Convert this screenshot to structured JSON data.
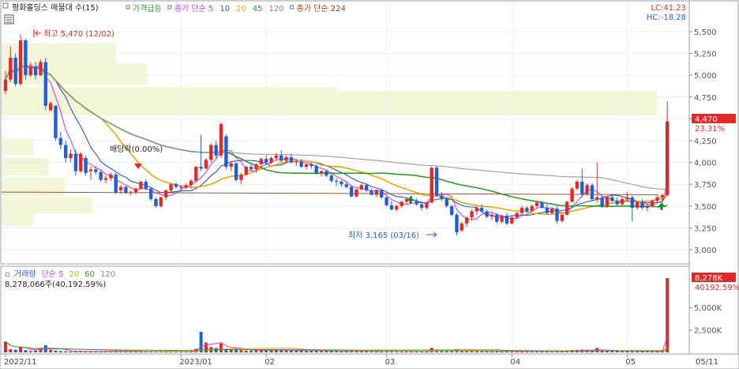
{
  "header": {
    "stock_title": "평화홀딩스 매물대 수(15)",
    "legend_items": [
      {
        "label": "가격급등",
        "color": "#2e9a2e"
      },
      {
        "label": "종가 단순 5",
        "color": "#d63bd6"
      },
      {
        "label": "10",
        "color": "#2b55d0"
      },
      {
        "label": "20",
        "color": "#e6a800"
      },
      {
        "label": "45",
        "color": "#2e9a2e"
      },
      {
        "label": "120",
        "color": "#888888"
      },
      {
        "label": "종가 단순 224",
        "color": "#8b4513"
      }
    ],
    "lc_label": "LC:41.23",
    "hc_label": "HC:-18.28"
  },
  "annotations": {
    "high_label": "최고 5,470 (12/02)",
    "low_label": "최저 3,165 (03/16)",
    "dividend_label": "배당락(0.00%)"
  },
  "price_panel": {
    "current_price": "4,470",
    "change_pct": "23.31%",
    "y_ticks": [
      "5,500",
      "5,250",
      "5,000",
      "4,750",
      "4,500",
      "4,250",
      "4,000",
      "3,750",
      "3,500",
      "3,250",
      "3,000"
    ]
  },
  "volume_panel": {
    "legend": [
      {
        "label": "거래량",
        "color": "#2b55d0"
      },
      {
        "label": "단순 5",
        "color": "#d63bd6"
      },
      {
        "label": "20",
        "color": "#e6a800"
      },
      {
        "label": "60",
        "color": "#2e9a2e"
      },
      {
        "label": "120",
        "color": "#888888"
      }
    ],
    "summary": "8,278,066주(40,192.59%)",
    "current_volume": "8,278K",
    "current_pct": "40192.59%",
    "y_ticks": [
      "5,000K",
      "2,500K"
    ]
  },
  "x_axis": {
    "labels": [
      "2022/11",
      "2023/01",
      "02",
      "03",
      "04",
      "05",
      "05/11"
    ]
  },
  "colors": {
    "up": "#e02a2a",
    "down": "#2060d0",
    "ma5": "#d63bd6",
    "ma10": "#2b55d0",
    "ma20": "#e6a800",
    "ma45": "#2e9a2e",
    "ma120": "#999999",
    "ma224": "#a0522d",
    "volume_profile": "#f3f6d6"
  },
  "chart_data": {
    "type": "candlestick",
    "title": "평화홀딩스 매물대 수(15)",
    "ylim": [
      2850,
      5600
    ],
    "annotations": {
      "high": {
        "value": 5470,
        "date": "12/02"
      },
      "low": {
        "value": 3165,
        "date": "03/16"
      },
      "last": {
        "value": 4470,
        "change_pct": 23.31
      }
    },
    "ohlc": [
      [
        4820,
        5050,
        4780,
        4950
      ],
      [
        4950,
        5330,
        4920,
        5200
      ],
      [
        5200,
        5250,
        4870,
        4900
      ],
      [
        4900,
        5470,
        4880,
        5400
      ],
      [
        5400,
        5420,
        4950,
        5000
      ],
      [
        5000,
        5150,
        4980,
        5100
      ],
      [
        5100,
        5150,
        4950,
        5000
      ],
      [
        5000,
        5180,
        4990,
        5150
      ],
      [
        5150,
        5200,
        4600,
        4650
      ],
      [
        4600,
        4700,
        4580,
        4680
      ],
      [
        4650,
        4660,
        4250,
        4280
      ],
      [
        4280,
        4350,
        4150,
        4200
      ],
      [
        4200,
        4250,
        4000,
        4050
      ],
      [
        4050,
        4150,
        4000,
        4100
      ],
      [
        4100,
        4150,
        3850,
        3900
      ],
      [
        3900,
        4120,
        3880,
        4100
      ],
      [
        4050,
        4080,
        3850,
        3880
      ],
      [
        3900,
        3950,
        3800,
        3920
      ],
      [
        3920,
        3960,
        3860,
        3890
      ],
      [
        3890,
        3910,
        3780,
        3800
      ],
      [
        3800,
        3850,
        3760,
        3820
      ],
      [
        3820,
        3880,
        3790,
        3860
      ],
      [
        3860,
        3880,
        3640,
        3660
      ],
      [
        3680,
        3740,
        3640,
        3720
      ],
      [
        3720,
        3730,
        3640,
        3650
      ],
      [
        3650,
        3680,
        3620,
        3660
      ],
      [
        3660,
        3720,
        3640,
        3700
      ],
      [
        3700,
        3790,
        3690,
        3780
      ],
      [
        3780,
        3810,
        3680,
        3700
      ],
      [
        3700,
        3720,
        3560,
        3580
      ],
      [
        3580,
        3600,
        3480,
        3500
      ],
      [
        3500,
        3610,
        3480,
        3600
      ],
      [
        3600,
        3690,
        3570,
        3680
      ],
      [
        3680,
        3760,
        3650,
        3750
      ],
      [
        3750,
        3770,
        3700,
        3720
      ],
      [
        3720,
        3740,
        3680,
        3710
      ],
      [
        3710,
        3760,
        3690,
        3740
      ],
      [
        3740,
        3810,
        3700,
        3790
      ],
      [
        3790,
        3960,
        3770,
        3950
      ],
      [
        3950,
        4320,
        3900,
        3930
      ],
      [
        3930,
        4050,
        3920,
        4030
      ],
      [
        4030,
        4220,
        4000,
        4200
      ],
      [
        4200,
        4250,
        4050,
        4080
      ],
      [
        4080,
        4460,
        4050,
        4440
      ],
      [
        4300,
        4320,
        3920,
        3950
      ],
      [
        3950,
        4010,
        3900,
        3990
      ],
      [
        3990,
        4000,
        3780,
        3800
      ],
      [
        3800,
        3880,
        3750,
        3860
      ],
      [
        3860,
        3960,
        3850,
        3950
      ],
      [
        3950,
        3980,
        3900,
        3920
      ],
      [
        3920,
        3990,
        3880,
        3980
      ],
      [
        3980,
        4060,
        3950,
        4040
      ],
      [
        4040,
        4080,
        3970,
        4000
      ],
      [
        4000,
        4070,
        3980,
        4050
      ],
      [
        4050,
        4110,
        4020,
        4080
      ],
      [
        4080,
        4140,
        4000,
        4020
      ],
      [
        4020,
        4080,
        3990,
        4060
      ],
      [
        4060,
        4100,
        3990,
        4000
      ],
      [
        4000,
        4030,
        3960,
        4010
      ],
      [
        4010,
        4040,
        3940,
        3950
      ],
      [
        3950,
        3990,
        3920,
        3980
      ],
      [
        3980,
        4000,
        3930,
        3960
      ],
      [
        3960,
        3980,
        3860,
        3880
      ],
      [
        3880,
        3910,
        3840,
        3900
      ],
      [
        3900,
        3920,
        3830,
        3850
      ],
      [
        3850,
        3870,
        3770,
        3790
      ],
      [
        3790,
        3820,
        3730,
        3780
      ],
      [
        3780,
        3800,
        3720,
        3750
      ],
      [
        3750,
        3780,
        3700,
        3720
      ],
      [
        3720,
        3740,
        3600,
        3610
      ],
      [
        3610,
        3700,
        3600,
        3690
      ],
      [
        3690,
        3760,
        3680,
        3740
      ],
      [
        3740,
        3760,
        3660,
        3680
      ],
      [
        3680,
        3700,
        3620,
        3630
      ],
      [
        3630,
        3690,
        3600,
        3680
      ],
      [
        3680,
        3700,
        3580,
        3600
      ],
      [
        3600,
        3610,
        3500,
        3510
      ],
      [
        3510,
        3560,
        3450,
        3460
      ],
      [
        3460,
        3520,
        3440,
        3500
      ],
      [
        3500,
        3560,
        3480,
        3550
      ],
      [
        3550,
        3600,
        3520,
        3580
      ],
      [
        3580,
        3620,
        3540,
        3560
      ],
      [
        3560,
        3590,
        3500,
        3520
      ],
      [
        3520,
        3540,
        3450,
        3480
      ],
      [
        3480,
        3550,
        3460,
        3540
      ],
      [
        3540,
        3950,
        3530,
        3940
      ],
      [
        3940,
        3960,
        3600,
        3620
      ],
      [
        3620,
        3660,
        3560,
        3580
      ],
      [
        3580,
        3600,
        3480,
        3500
      ],
      [
        3500,
        3510,
        3380,
        3400
      ],
      [
        3400,
        3420,
        3165,
        3200
      ],
      [
        3220,
        3320,
        3200,
        3300
      ],
      [
        3300,
        3380,
        3260,
        3370
      ],
      [
        3370,
        3460,
        3340,
        3440
      ],
      [
        3440,
        3500,
        3400,
        3480
      ],
      [
        3480,
        3520,
        3420,
        3440
      ],
      [
        3440,
        3460,
        3360,
        3380
      ],
      [
        3380,
        3420,
        3340,
        3400
      ],
      [
        3400,
        3420,
        3300,
        3320
      ],
      [
        3320,
        3400,
        3300,
        3390
      ],
      [
        3390,
        3420,
        3280,
        3300
      ],
      [
        3300,
        3380,
        3290,
        3370
      ],
      [
        3370,
        3430,
        3350,
        3420
      ],
      [
        3420,
        3500,
        3400,
        3480
      ],
      [
        3480,
        3500,
        3420,
        3440
      ],
      [
        3440,
        3520,
        3430,
        3500
      ],
      [
        3500,
        3560,
        3480,
        3540
      ],
      [
        3540,
        3560,
        3470,
        3480
      ],
      [
        3480,
        3520,
        3400,
        3420
      ],
      [
        3420,
        3480,
        3410,
        3470
      ],
      [
        3470,
        3500,
        3300,
        3330
      ],
      [
        3330,
        3420,
        3310,
        3400
      ],
      [
        3400,
        3560,
        3390,
        3550
      ],
      [
        3550,
        3720,
        3540,
        3700
      ],
      [
        3700,
        3800,
        3680,
        3780
      ],
      [
        3780,
        3930,
        3600,
        3640
      ],
      [
        3640,
        3760,
        3620,
        3740
      ],
      [
        3740,
        3760,
        3560,
        3580
      ],
      [
        3580,
        4000,
        3540,
        3600
      ],
      [
        3600,
        3620,
        3480,
        3500
      ],
      [
        3500,
        3620,
        3480,
        3600
      ],
      [
        3600,
        3640,
        3540,
        3560
      ],
      [
        3560,
        3600,
        3500,
        3520
      ],
      [
        3520,
        3600,
        3500,
        3580
      ],
      [
        3580,
        3660,
        3560,
        3600
      ],
      [
        3600,
        3620,
        3320,
        3480
      ],
      [
        3480,
        3560,
        3460,
        3540
      ],
      [
        3540,
        3580,
        3460,
        3480
      ],
      [
        3480,
        3520,
        3440,
        3500
      ],
      [
        3500,
        3580,
        3480,
        3560
      ],
      [
        3560,
        3620,
        3540,
        3600
      ],
      [
        3600,
        3640,
        3560,
        3626
      ],
      [
        3626,
        4700,
        3610,
        4470
      ]
    ],
    "volume_ylim": [
      0,
      9000
    ],
    "volume": [
      1200,
      350,
      300,
      600,
      250,
      150,
      200,
      500,
      800,
      300,
      200,
      150,
      120,
      100,
      100,
      150,
      120,
      100,
      100,
      120,
      100,
      90,
      150,
      120,
      100,
      100,
      100,
      120,
      110,
      150,
      120,
      100,
      100,
      120,
      110,
      100,
      100,
      130,
      400,
      2300,
      1100,
      600,
      500,
      1000,
      400,
      300,
      450,
      250,
      200,
      200,
      220,
      300,
      260,
      250,
      280,
      230,
      220,
      210,
      200,
      200,
      180,
      180,
      200,
      170,
      170,
      160,
      160,
      150,
      150,
      170,
      150,
      140,
      140,
      130,
      140,
      140,
      160,
      150,
      130,
      130,
      130,
      130,
      120,
      130,
      150,
      500,
      240,
      180,
      150,
      180,
      350,
      200,
      150,
      150,
      140,
      140,
      130,
      130,
      140,
      130,
      130,
      130,
      130,
      140,
      130,
      130,
      150,
      140,
      140,
      130,
      150,
      140,
      200,
      260,
      280,
      300,
      220,
      180,
      500,
      160,
      160,
      150,
      140,
      140,
      150,
      200,
      140,
      130,
      130,
      130,
      140,
      150,
      8278
    ],
    "volume_summary": "8,278,066주(40,192.59%)",
    "x_labels": [
      "2022/11",
      "2023/01",
      "02",
      "03",
      "04",
      "05",
      "05/11"
    ],
    "moving_averages": [
      "종가 단순 5",
      "10",
      "20",
      "45",
      "120",
      "종가 단순 224"
    ],
    "last_value_badge": "4,470"
  }
}
